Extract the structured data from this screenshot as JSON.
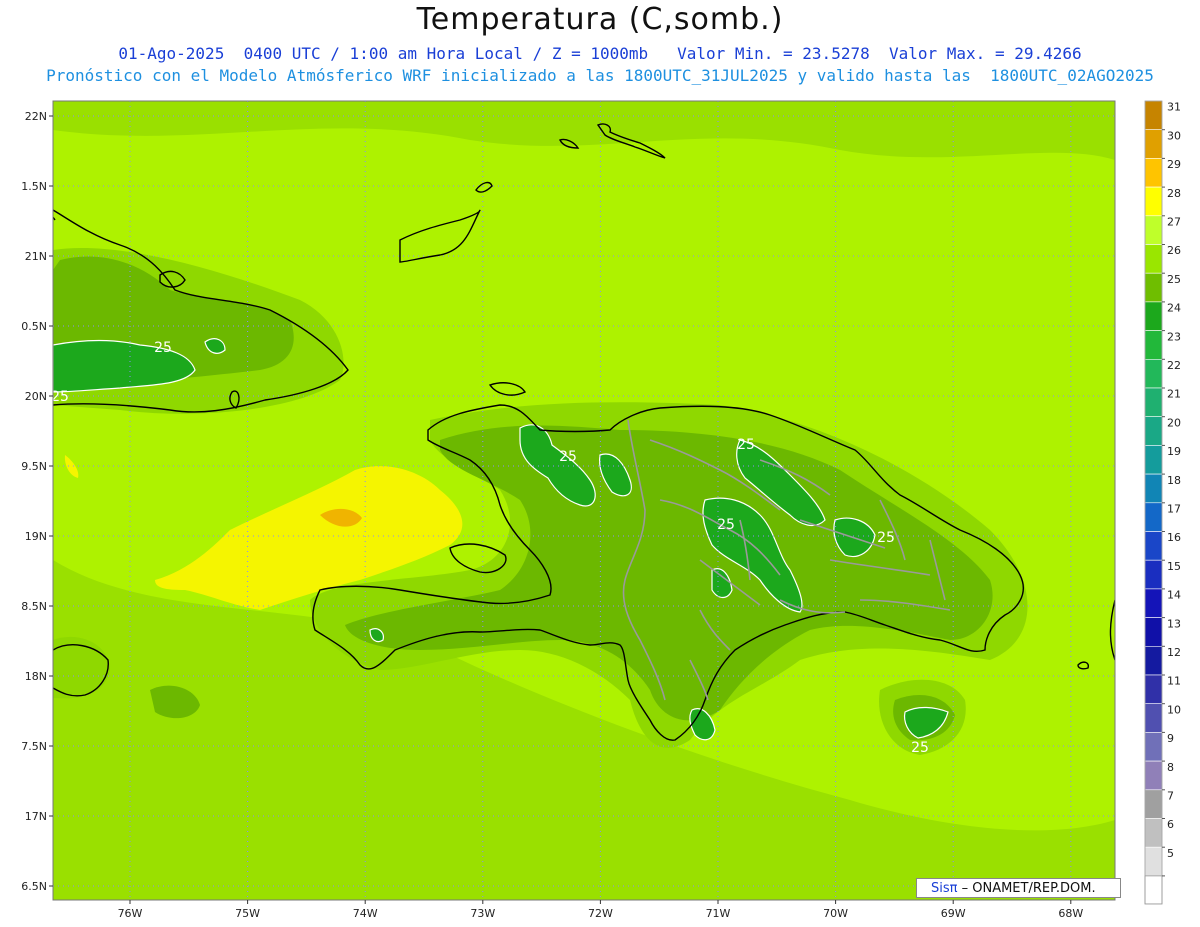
{
  "title": "Temperatura (C,somb.)",
  "subtitle_line1": "01-Ago-2025  0400 UTC / 1:00 am Hora Local / Z = 1000mb   Valor Min. = 23.5278  Valor Max. = 29.4266",
  "subtitle_line2": "Pronóstico con el Modelo Atmósferico WRF inicializado a las 1800UTC_31JUL2025 y valido hasta las  1800UTC_02AGO2025",
  "credit": {
    "logo": "Sisπ",
    "text": "– ONAMET/REP.DOM."
  },
  "map": {
    "lat_ticks": [
      "22N",
      "1.5N",
      "21N",
      "0.5N",
      "20N",
      "9.5N",
      "19N",
      "8.5N",
      "18N",
      "7.5N",
      "17N",
      "6.5N"
    ],
    "lon_ticks": [
      "76W",
      "75W",
      "74W",
      "73W",
      "72W",
      "71W",
      "70W",
      "69W",
      "68W"
    ],
    "contour_labels": [
      "25",
      "25",
      "25",
      "25",
      "25",
      "25",
      "25"
    ],
    "colors": {
      "c27": "#aef200",
      "c26": "#8fd800",
      "c25": "#6cb800",
      "c24": "#1fa81f",
      "c28": "#f5f500",
      "c29": "#f0c000",
      "coast": "#000000",
      "border": "#a0a0a0"
    }
  },
  "colorbar": {
    "labels": [
      "31",
      "30",
      "29",
      "28",
      "27",
      "26",
      "25",
      "24",
      "23",
      "22",
      "21",
      "20",
      "19",
      "18",
      "17",
      "16",
      "15",
      "14",
      "13",
      "12",
      "11",
      "10",
      "9",
      "8",
      "7",
      "6",
      "5"
    ],
    "colors": [
      "#c68400",
      "#e0a000",
      "#ffc400",
      "#ffff00",
      "#bfff2a",
      "#9ae600",
      "#6fbe00",
      "#1ca81c",
      "#22b83a",
      "#22b85a",
      "#1fb070",
      "#1aa886",
      "#149c9c",
      "#1185b5",
      "#1368c8",
      "#1a46c8",
      "#1a2ec0",
      "#1414b8",
      "#1010a8",
      "#141aa0",
      "#3030a8",
      "#5050b0",
      "#7070b8",
      "#9080b8",
      "#a0a0a0",
      "#c0c0c0",
      "#e0e0e0"
    ]
  }
}
